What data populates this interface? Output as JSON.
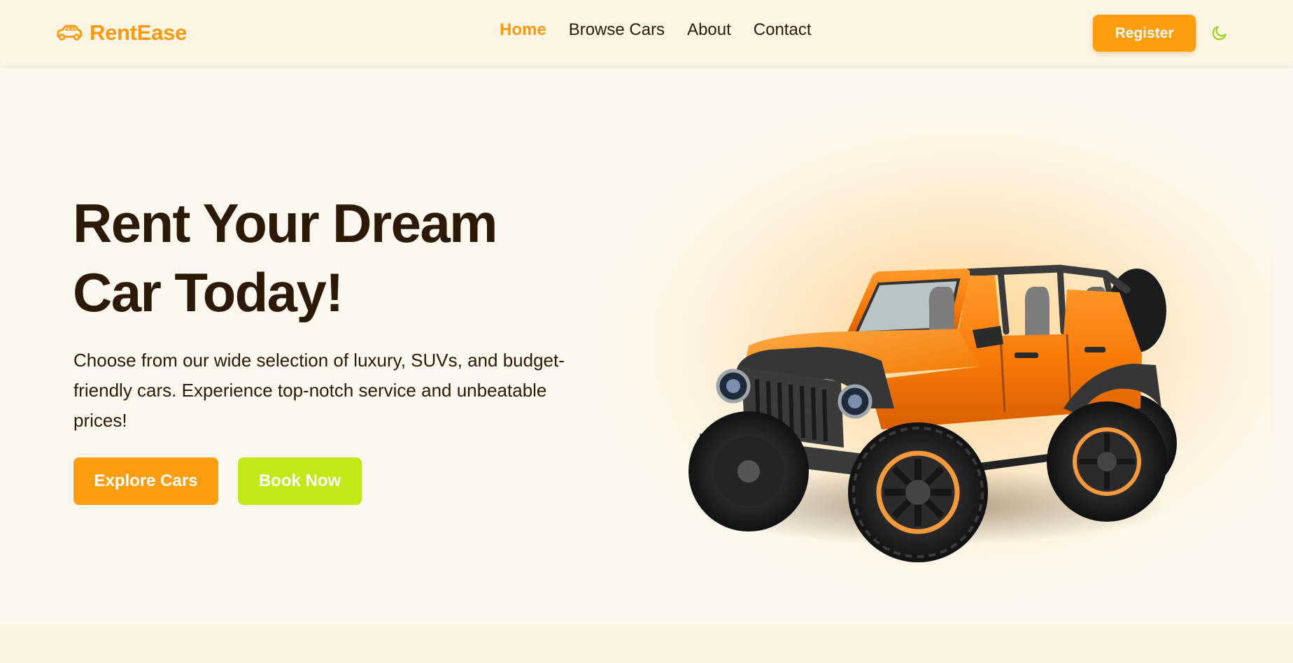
{
  "brand": {
    "name": "RentEase",
    "icon": "car-icon",
    "color": "#fa9a0c"
  },
  "nav": {
    "links": [
      {
        "label": "Home",
        "active": true
      },
      {
        "label": "Browse Cars",
        "active": false
      },
      {
        "label": "About",
        "active": false
      },
      {
        "label": "Contact",
        "active": false
      }
    ],
    "register_label": "Register",
    "theme_toggle_icon": "moon-icon"
  },
  "hero": {
    "title": "Rent Your Dream Car Today!",
    "description": "Choose from our wide selection of luxury, SUVs, and budget-friendly cars. Experience top-notch service and unbeatable prices!",
    "explore_label": "Explore Cars",
    "book_label": "Book Now",
    "image": "orange-jeep-illustration"
  },
  "colors": {
    "primary": "#fd9e0e",
    "accent_lime": "#c1e817",
    "text_dark": "#2a1a06",
    "background": "#fdf8ef",
    "moon": "#9ad41a"
  }
}
